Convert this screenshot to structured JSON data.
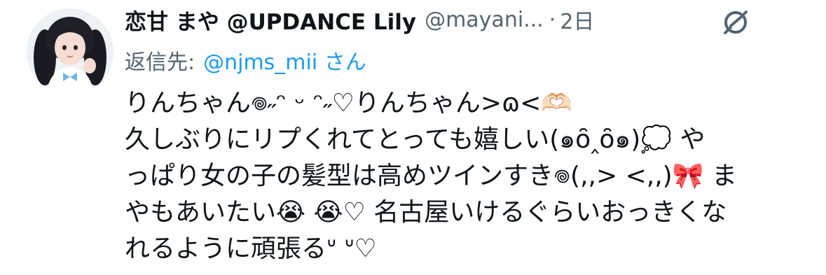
{
  "author": {
    "display_name": "恋甘 まや @UPDANCE Lily",
    "handle": "@mayani...",
    "separator": "·",
    "timestamp": "2日"
  },
  "reply": {
    "prefix": "返信先:",
    "target": "@njms_mii さん"
  },
  "body_lines": [
    "りんちゃん𖦹˶ᵔ ᵕ ᵔ˶♡りんちゃん>ɷ<🫶🏻",
    "久しぶりにリプくれてとっても嬉しい(๑ȏ‸ȏ๑)💭 や",
    "っぱり女の子の髪型は高めツインすき𖦹(,,> <,,)🎀 ま",
    "やもあいたい😭 😭♡ 名古屋いけるぐらいおっきくな",
    "れるように頑張るᐡ ᐡ♡"
  ],
  "icons": {
    "grok": "grok-slash-icon",
    "avatar": "avatar-image"
  },
  "colors": {
    "text_primary": "#0f1419",
    "text_secondary": "#536471",
    "link": "#1d9bf0"
  }
}
